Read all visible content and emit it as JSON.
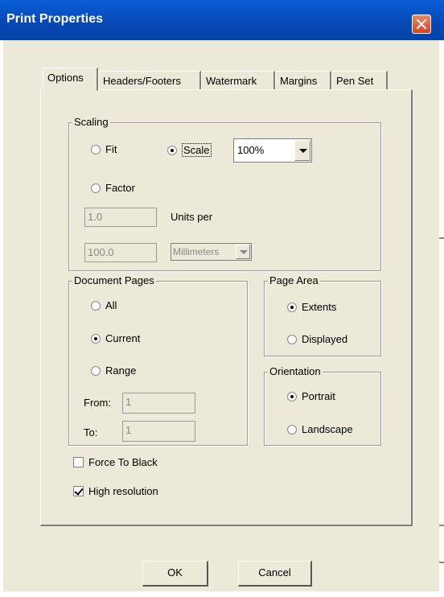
{
  "window": {
    "title": "Print Properties"
  },
  "tabs": [
    {
      "label": "Options",
      "active": true
    },
    {
      "label": "Headers/Footers",
      "active": false
    },
    {
      "label": "Watermark",
      "active": false
    },
    {
      "label": "Margins",
      "active": false
    },
    {
      "label": "Pen Set",
      "active": false
    }
  ],
  "scaling": {
    "legend": "Scaling",
    "fit_label": "Fit",
    "scale_label": "Scale",
    "factor_label": "Factor",
    "mode": "Scale",
    "scale_value": "100%",
    "factor_value": "1.0",
    "units_per_label": "Units per",
    "per_value": "100.0",
    "unit": "Millimeters"
  },
  "document_pages": {
    "legend": "Document Pages",
    "all_label": "All",
    "current_label": "Current",
    "range_label": "Range",
    "selected": "Current",
    "from_label": "From:",
    "from_value": "1",
    "to_label": "To:",
    "to_value": "1"
  },
  "page_area": {
    "legend": "Page Area",
    "extents_label": "Extents",
    "displayed_label": "Displayed",
    "selected": "Extents"
  },
  "orientation": {
    "legend": "Orientation",
    "portrait_label": "Portrait",
    "landscape_label": "Landscape",
    "selected": "Portrait"
  },
  "options": {
    "force_black_label": "Force To Black",
    "force_black_checked": false,
    "high_res_label": "High resolution",
    "high_res_checked": true
  },
  "buttons": {
    "ok": "OK",
    "cancel": "Cancel"
  },
  "colors": {
    "titlebar": "#0a5fd8",
    "dialog_bg": "#ece9d8",
    "close_red": "#d5441c"
  }
}
